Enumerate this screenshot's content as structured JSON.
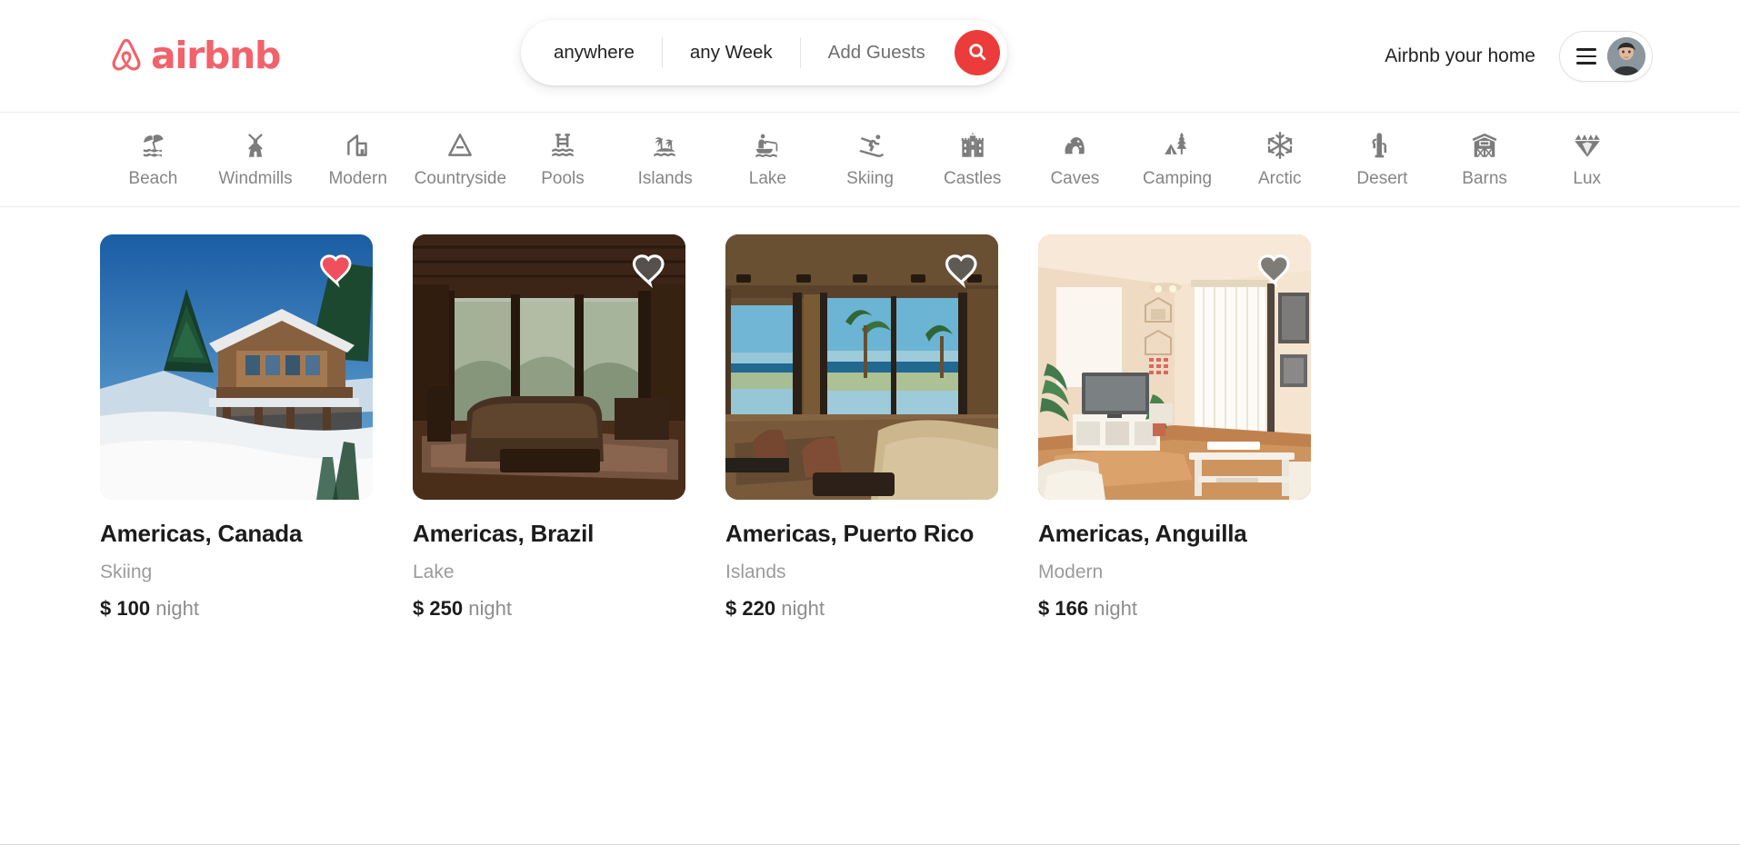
{
  "brand": {
    "name": "airbnb",
    "logo_icon": "airbnb-belo-icon",
    "color": "#f2626b"
  },
  "search": {
    "location_value": "anywhere",
    "dates_value": "any Week",
    "guests_placeholder": "Add Guests",
    "search_icon": "search-icon",
    "button_color": "#ec3b3b"
  },
  "header": {
    "host_link": "Airbnb your home",
    "menu_icon": "hamburger-menu-icon",
    "avatar_icon": "user-avatar"
  },
  "categories": [
    {
      "label": "Beach",
      "icon": "beach-umbrella-icon"
    },
    {
      "label": "Windmills",
      "icon": "windmill-icon"
    },
    {
      "label": "Modern",
      "icon": "modern-building-icon"
    },
    {
      "label": "Countryside",
      "icon": "countryside-barn-icon"
    },
    {
      "label": "Pools",
      "icon": "pool-ladder-icon"
    },
    {
      "label": "Islands",
      "icon": "island-palm-icon"
    },
    {
      "label": "Lake",
      "icon": "lake-fishing-boat-icon"
    },
    {
      "label": "Skiing",
      "icon": "skier-icon"
    },
    {
      "label": "Castles",
      "icon": "castle-icon"
    },
    {
      "label": "Caves",
      "icon": "cave-icon"
    },
    {
      "label": "Camping",
      "icon": "camping-tent-icon"
    },
    {
      "label": "Arctic",
      "icon": "snowflake-icon"
    },
    {
      "label": "Desert",
      "icon": "cactus-icon"
    },
    {
      "label": "Barns",
      "icon": "barn-icon"
    },
    {
      "label": "Lux",
      "icon": "diamond-icon"
    }
  ],
  "listings": [
    {
      "title": "Americas, Canada",
      "category": "Skiing",
      "currency": "$",
      "price": "100",
      "period": "night",
      "favorited": true,
      "heart_icon": "heart-filled-icon",
      "image_alt": "snowy wooden chalet with pine trees"
    },
    {
      "title": "Americas, Brazil",
      "category": "Lake",
      "currency": "$",
      "price": "250",
      "period": "night",
      "favorited": false,
      "heart_icon": "heart-outline-icon",
      "image_alt": "wooden cabin living room with large windows"
    },
    {
      "title": "Americas, Puerto Rico",
      "category": "Islands",
      "currency": "$",
      "price": "220",
      "period": "night",
      "favorited": false,
      "heart_icon": "heart-outline-icon",
      "image_alt": "modern living room with ocean view"
    },
    {
      "title": "Americas, Anguilla",
      "category": "Modern",
      "currency": "$",
      "price": "166",
      "period": "night",
      "favorited": false,
      "heart_icon": "heart-outline-icon",
      "image_alt": "bright apartment living room with tv"
    }
  ]
}
